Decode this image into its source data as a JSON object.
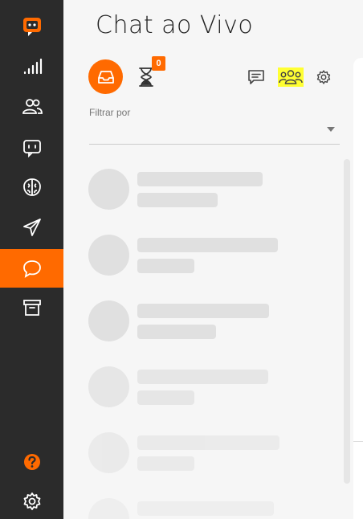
{
  "sidebar": {
    "items": [
      {
        "id": "logo",
        "icon": "chat-logo-icon"
      },
      {
        "id": "reports",
        "icon": "signal-bars-icon"
      },
      {
        "id": "contacts",
        "icon": "users-icon"
      },
      {
        "id": "bots",
        "icon": "bot-icon"
      },
      {
        "id": "ai",
        "icon": "brain-icon"
      },
      {
        "id": "campaigns",
        "icon": "paper-plane-icon"
      },
      {
        "id": "live-chat",
        "icon": "chat-bubble-icon",
        "active": true
      },
      {
        "id": "archive",
        "icon": "archive-icon"
      },
      {
        "id": "help",
        "icon": "help-icon"
      },
      {
        "id": "settings",
        "icon": "gear-icon"
      }
    ],
    "accent": "#ff6a00",
    "background": "#2b2b2b"
  },
  "header": {
    "title": "Chat ao Vivo"
  },
  "toolbar": {
    "inbox_icon": "inbox-icon",
    "waiting_icon": "hourglass-icon",
    "waiting_count": "0",
    "messages_icon": "message-square-icon",
    "team_icon": "team-icon",
    "settings_icon": "gear-icon"
  },
  "filter": {
    "label": "Filtrar por",
    "selected": ""
  },
  "colors": {
    "accent": "#ff6a00",
    "highlight": "#ffff33",
    "skeleton": "#e0e0e0"
  }
}
